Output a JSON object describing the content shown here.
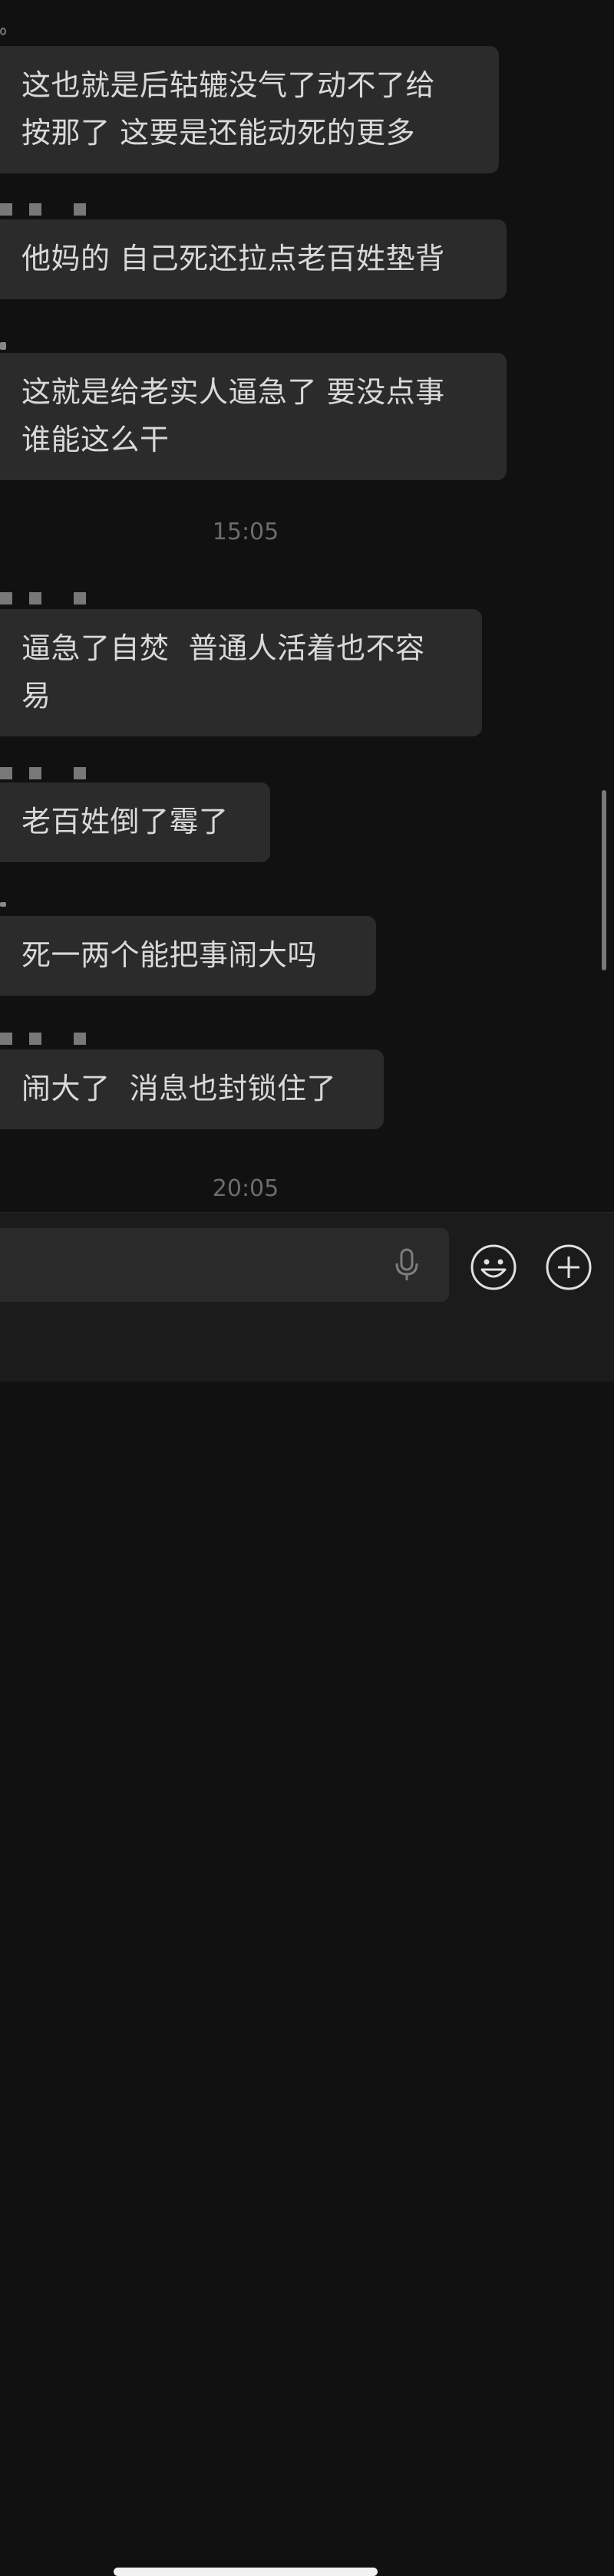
{
  "messages": [
    {
      "text": "这也就是后轱辘没气了动不了给\n按那了 这要是还能动死的更多"
    },
    {
      "text": "他妈的 自己死还拉点老百姓垫背"
    },
    {
      "text": "这就是给老实人逼急了 要没点事\n谁能这么干"
    },
    {
      "text": "逼急了自焚  普通人活着也不容\n易"
    },
    {
      "text": "老百姓倒了霉了"
    },
    {
      "text": "死一两个能把事闹大吗"
    },
    {
      "text": "闹大了  消息也封锁住了"
    }
  ],
  "timestamps": [
    "15:05",
    "20:05"
  ],
  "input": {
    "placeholder": "",
    "voice_icon": "microphone-icon",
    "emoji_icon": "smiley-face-icon",
    "more_icon": "plus-circle-icon"
  },
  "colors": {
    "background": "#111111",
    "bubble": "#2b2b2b",
    "text": "#d9d9d9",
    "timestamp": "#6c6c6c"
  }
}
